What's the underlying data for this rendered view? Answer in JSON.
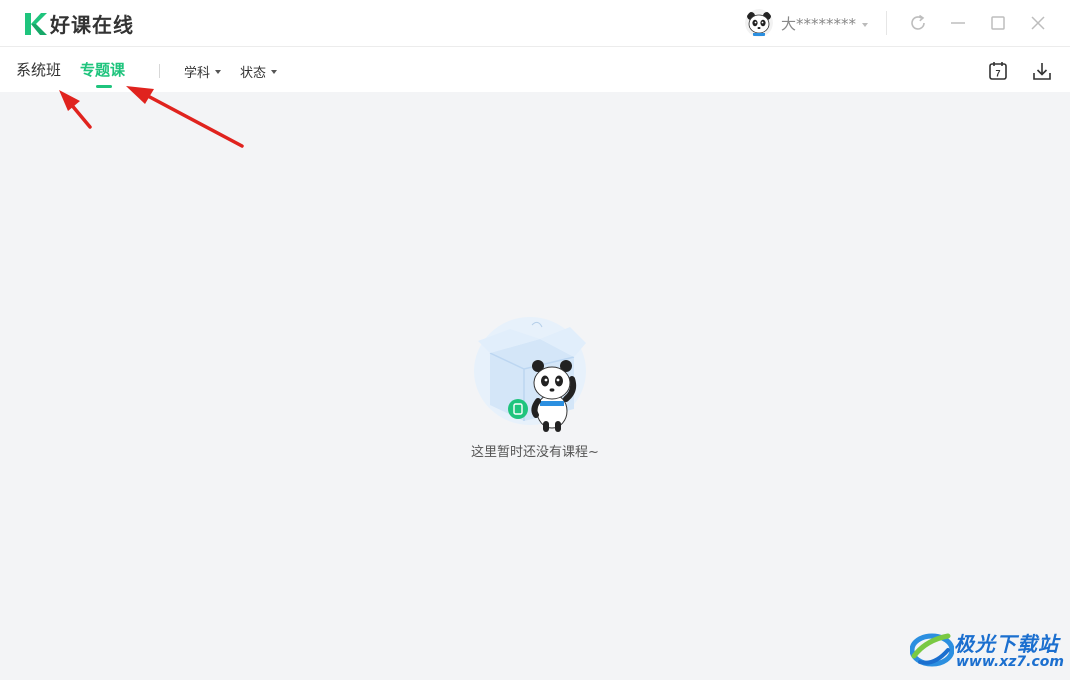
{
  "app": {
    "name": "好课在线",
    "brand_color": "#1fc47d"
  },
  "user": {
    "name": "大********",
    "avatar": "panda-avatar"
  },
  "window_controls": [
    "refresh-icon",
    "minimize-icon",
    "maximize-icon",
    "close-icon"
  ],
  "nav": {
    "tabs": [
      {
        "label": "系统班",
        "active": false
      },
      {
        "label": "专题课",
        "active": true
      }
    ],
    "filters": [
      {
        "label": "学科"
      },
      {
        "label": "状态"
      }
    ],
    "calendar_day": "7",
    "right_icons": [
      "calendar-icon",
      "download-icon"
    ]
  },
  "empty_state": {
    "message": "这里暂时还没有课程~",
    "illustration": "panda-with-box"
  },
  "watermark": {
    "title": "极光下载站",
    "url": "www.xz7.com"
  },
  "colors": {
    "annotation_arrow": "#e0231e",
    "page_background": "#f3f4f6"
  }
}
